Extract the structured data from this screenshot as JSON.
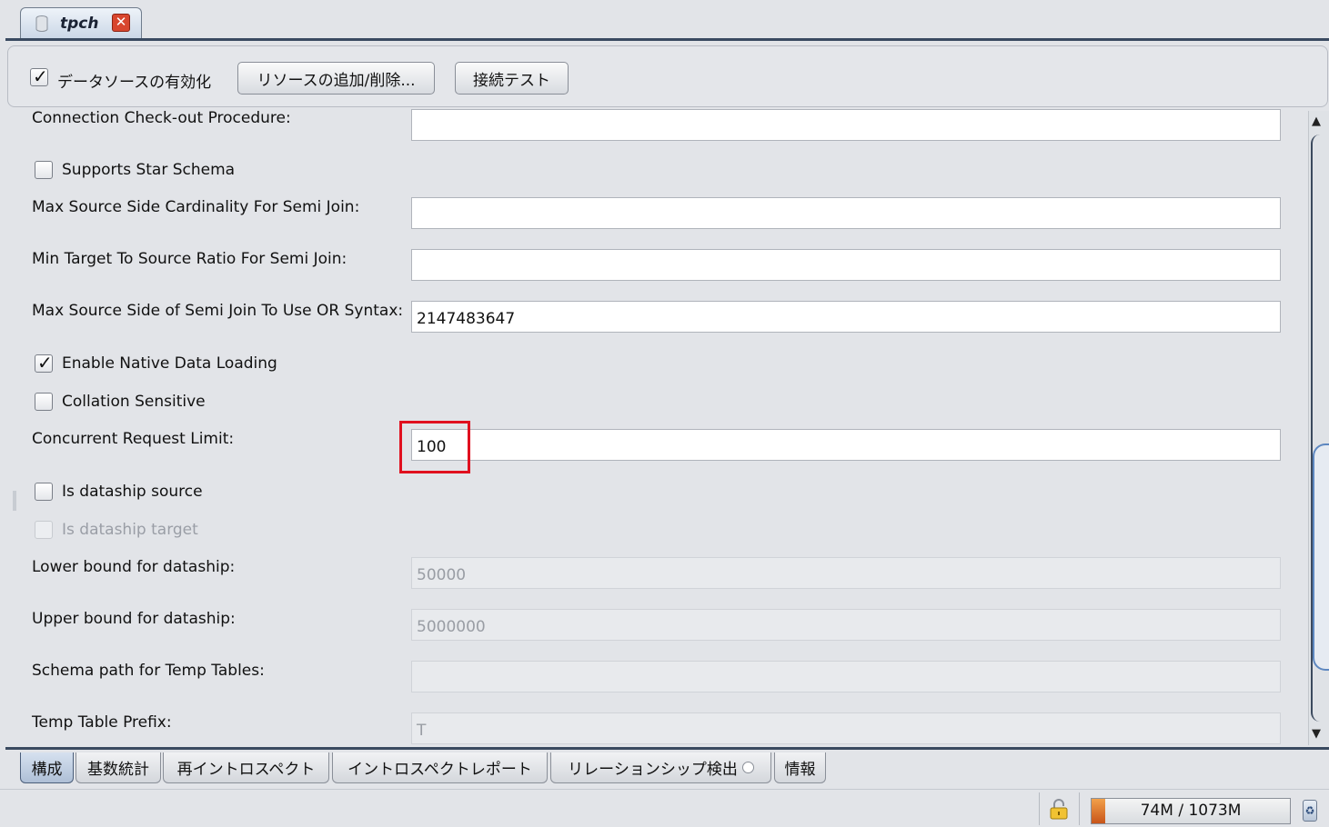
{
  "tab": {
    "title": "tpch",
    "close_glyph": "✕",
    "icon": "database-icon"
  },
  "toolbar": {
    "enable_label": "データソースの有効化",
    "enable_checked": true,
    "add_remove_button": "リソースの追加/削除...",
    "test_button": "接続テスト"
  },
  "form": {
    "checkout_label": "Connection Check-out Procedure:",
    "checkout_value": "",
    "star_schema_label": "Supports Star Schema",
    "max_card_label": "Max Source Side Cardinality For Semi Join:",
    "max_card_value": "",
    "min_ratio_label": "Min Target To Source Ratio For Semi Join:",
    "min_ratio_value": "",
    "max_or_label": "Max Source Side of Semi Join To Use OR Syntax:",
    "max_or_value": "2147483647",
    "native_loading_label": "Enable Native Data Loading",
    "collation_label": "Collation Sensitive",
    "concurrent_label": "Concurrent Request Limit:",
    "concurrent_value": "100",
    "is_source_label": "Is dataship source",
    "is_target_label": "Is dataship target",
    "lower_label": "Lower bound for dataship:",
    "lower_value": "50000",
    "upper_label": "Upper bound for dataship:",
    "upper_value": "5000000",
    "schema_path_label": "Schema path for Temp Tables:",
    "schema_path_value": "",
    "prefix_label": "Temp Table Prefix:",
    "prefix_value": "T"
  },
  "scrollbar": {
    "up": "▲",
    "down": "▼"
  },
  "bottom_tabs": [
    "構成",
    "基数統計",
    "再イントロスペクト",
    "イントロスペクトレポート",
    "リレーションシップ検出",
    "情報"
  ],
  "status": {
    "memory": "74M / 1073M",
    "memory_used_fraction": 0.07,
    "gc_glyph": "♻"
  },
  "colors": {
    "highlight": "#e0101f",
    "accent": "#3a4a60",
    "memory_fill": "#e07a30"
  }
}
